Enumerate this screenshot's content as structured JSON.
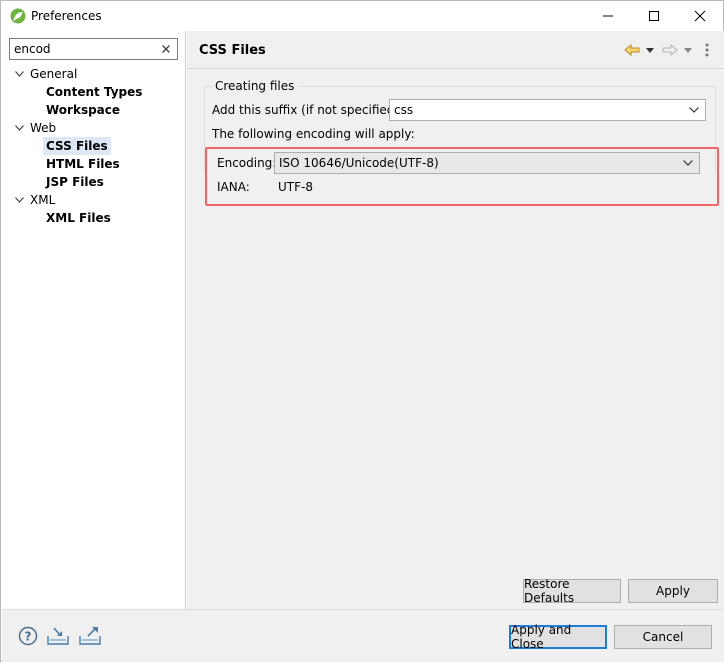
{
  "window": {
    "title": "Preferences",
    "accent_color": "#6db33f"
  },
  "filter": {
    "value": "encod"
  },
  "tree": {
    "items": [
      {
        "label": "General",
        "expanded": true
      },
      {
        "label": "Content Types"
      },
      {
        "label": "Workspace"
      },
      {
        "label": "Web",
        "expanded": true
      },
      {
        "label": "CSS Files",
        "selected": true
      },
      {
        "label": "HTML Files"
      },
      {
        "label": "JSP Files"
      },
      {
        "label": "XML",
        "expanded": true
      },
      {
        "label": "XML Files"
      }
    ]
  },
  "page": {
    "title": "CSS Files",
    "group_title": "Creating files",
    "suffix_label": "Add this suffix (if not specified):",
    "suffix_value": "css",
    "encoding_note": "The following encoding will apply:",
    "encoding_label": "Encoding:",
    "encoding_value": "ISO 10646/Unicode(UTF-8)",
    "iana_label": "IANA:",
    "iana_value": "UTF-8",
    "highlight_color": "#f06565"
  },
  "buttons": {
    "restore_defaults": "Restore Defaults",
    "apply": "Apply",
    "apply_and_close": "Apply and Close",
    "cancel": "Cancel"
  },
  "icons": {
    "titlebar": [
      "app-icon",
      "minimize-icon",
      "maximize-icon",
      "close-icon"
    ],
    "header": [
      "back-arrow-icon",
      "back-dropdown-icon",
      "forward-arrow-icon",
      "forward-dropdown-icon",
      "view-menu-icon"
    ],
    "bottom": [
      "help-icon",
      "import-icon",
      "export-icon"
    ]
  }
}
